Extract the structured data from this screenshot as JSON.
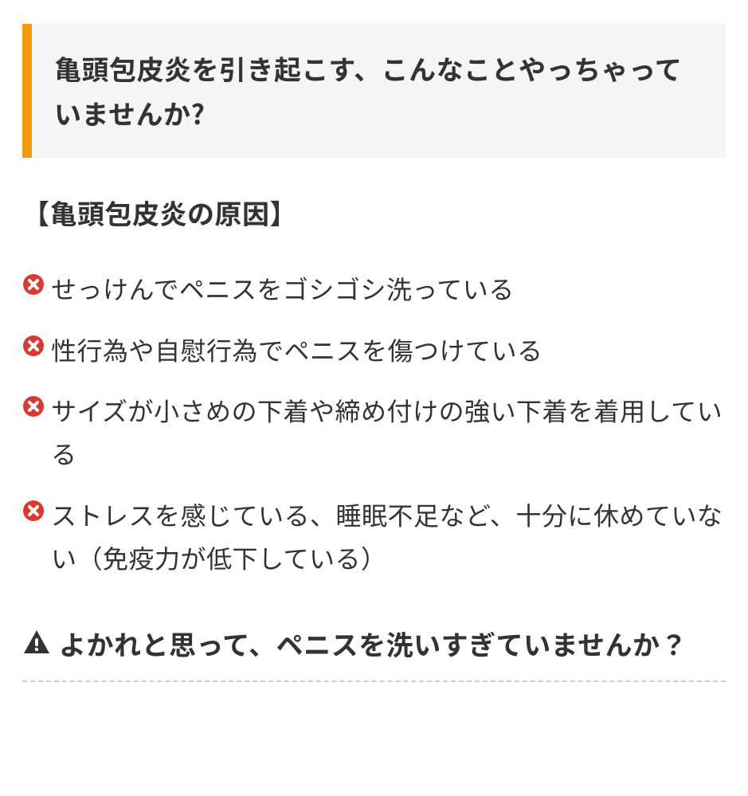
{
  "header": {
    "title": "亀頭包皮炎を引き起こす、こんなことやっちゃっていませんか?"
  },
  "section": {
    "title": "【亀頭包皮炎の原因】"
  },
  "causes": [
    {
      "text": "せっけんでペニスをゴシゴシ洗っている"
    },
    {
      "text": "性行為や自慰行為でペニスを傷つけている"
    },
    {
      "text": "サイズが小さめの下着や締め付けの強い下着を着用している"
    },
    {
      "text": "ストレスを感じている、睡眠不足など、十分に休めていない（免疫力が低下している）"
    }
  ],
  "sub_heading": {
    "text": "よかれと思って、ペニスを洗いすぎていませんか？"
  }
}
